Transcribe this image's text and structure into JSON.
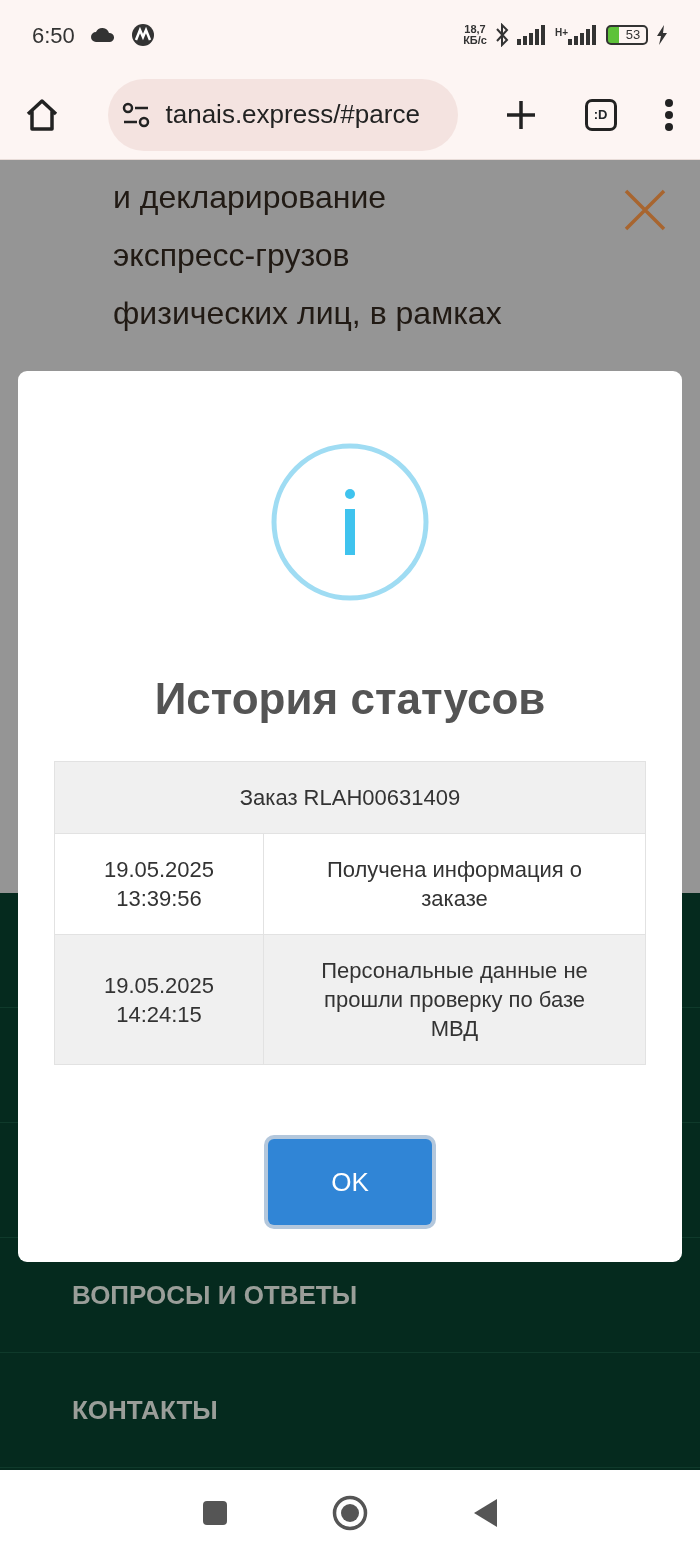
{
  "status_bar": {
    "time": "6:50",
    "net_speed": "18,7",
    "net_speed_unit": "КБ/с",
    "network_type": "H+",
    "battery": "53"
  },
  "browser": {
    "url": "tanais.express/#parce",
    "tab_switcher": ":D"
  },
  "page": {
    "text_lines": [
      "и декларирование",
      "экспресс-грузов",
      "физических лиц, в рамках"
    ],
    "menu": [
      {
        "label": "ВОПРОСЫ И ОТВЕТЫ"
      },
      {
        "label": "КОНТАКТЫ"
      }
    ]
  },
  "dialog": {
    "title": "История статусов",
    "table": {
      "header": "Заказ RLAH00631409",
      "rows": [
        {
          "datetime": "19.05.2025 13:39:56",
          "status": "Получена информация о заказе"
        },
        {
          "datetime": "19.05.2025 14:24:15",
          "status": "Персональные данные не прошли проверку по базе МВД"
        }
      ]
    },
    "button": "OK"
  }
}
